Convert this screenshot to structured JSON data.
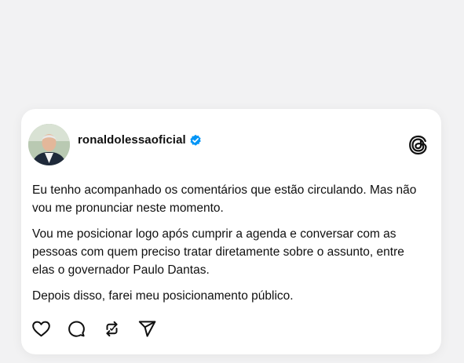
{
  "post": {
    "username": "ronaldolessaoficial",
    "verified": true,
    "paragraphs": [
      "Eu tenho acompanhado os comentários que estão circulando. Mas não vou me pronunciar neste momento.",
      "Vou me posicionar logo após cumprir a agenda e conversar com as pessoas com quem preciso tratar diretamente sobre o assunto, entre elas o governador Paulo Dantas.",
      "Depois disso, farei meu posicionamento público."
    ]
  },
  "icons": {
    "avatar": "profile-photo",
    "verified": "verified-badge-icon",
    "brand": "threads-logo-icon",
    "like": "heart-icon",
    "reply": "comment-icon",
    "repost": "repost-icon",
    "share": "send-icon"
  },
  "colors": {
    "background": "#f2f2f3",
    "card": "#ffffff",
    "text": "#101010",
    "verified": "#0095f6"
  }
}
